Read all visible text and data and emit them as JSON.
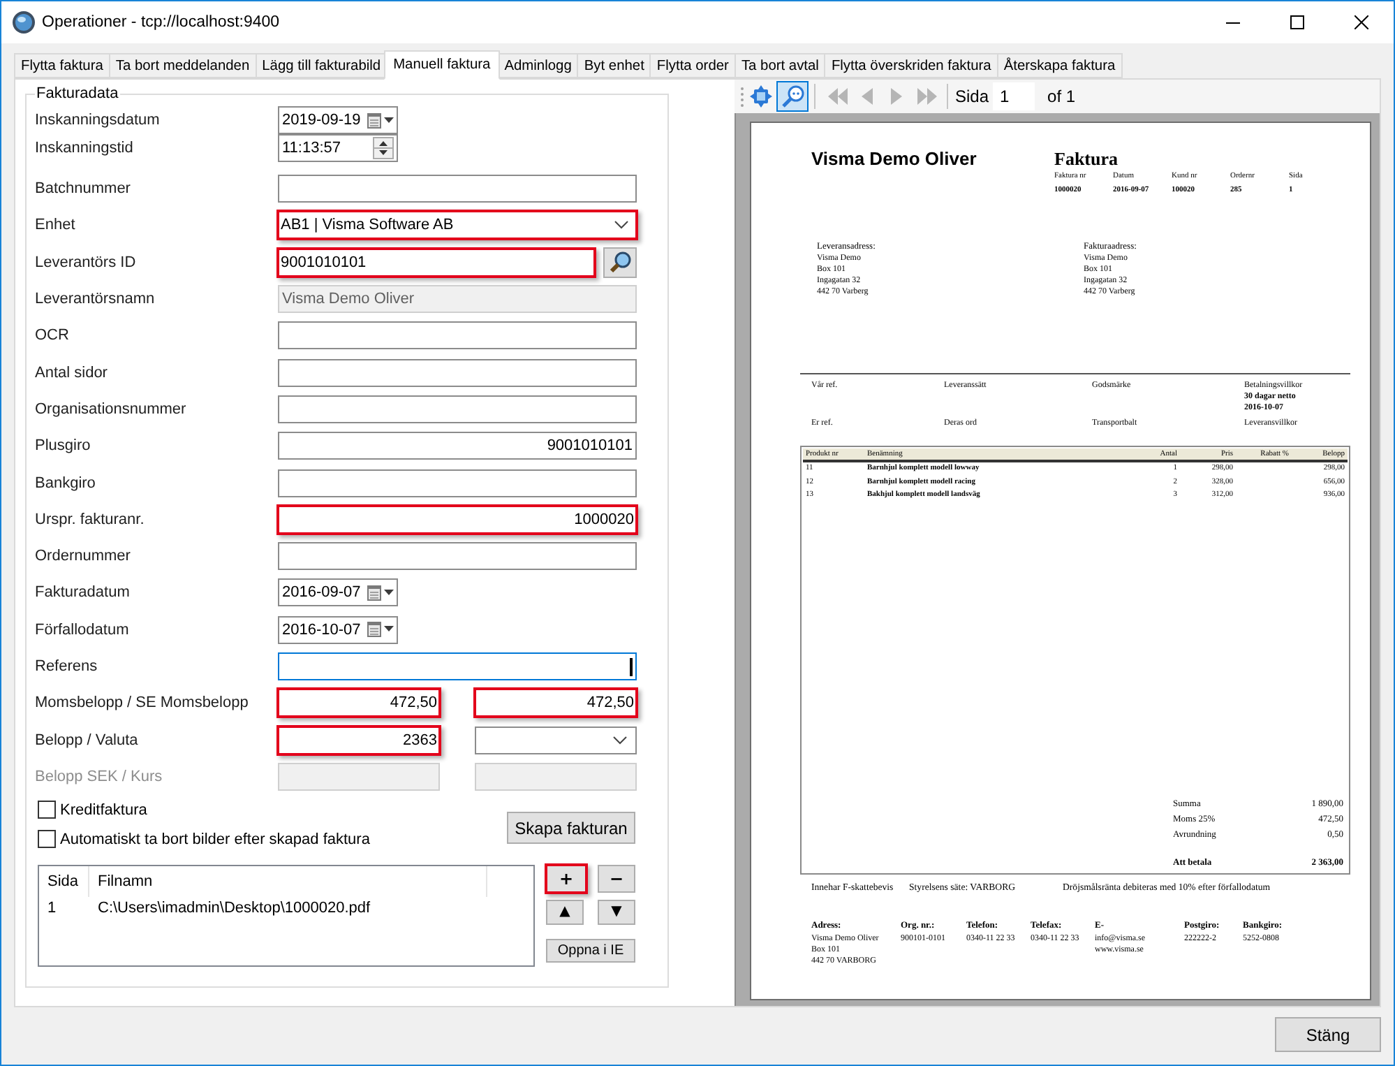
{
  "window": {
    "title": "Operationer - tcp://localhost:9400"
  },
  "tabs": [
    {
      "label": "Flytta faktura",
      "selected": false
    },
    {
      "label": "Ta bort meddelanden",
      "selected": false
    },
    {
      "label": "Lägg till fakturabild",
      "selected": false
    },
    {
      "label": "Manuell faktura",
      "selected": true
    },
    {
      "label": "Adminlogg",
      "selected": false
    },
    {
      "label": "Byt enhet",
      "selected": false
    },
    {
      "label": "Flytta order",
      "selected": false
    },
    {
      "label": "Ta bort avtal",
      "selected": false
    },
    {
      "label": "Flytta överskriden faktura",
      "selected": false
    },
    {
      "label": "Återskapa faktura",
      "selected": false
    }
  ],
  "form": {
    "title": "Fakturadata",
    "rows": [
      {
        "label": "Inskanningsdatum",
        "disabled": false,
        "inputs": [
          {
            "kind": "date",
            "value": "2019-09-19",
            "highlighted": false,
            "disabled": false,
            "focused": false
          }
        ]
      },
      {
        "label": "Inskanningstid",
        "disabled": false,
        "inputs": [
          {
            "kind": "time",
            "value": "11:13:57",
            "highlighted": false,
            "disabled": false,
            "focused": false
          }
        ]
      },
      {
        "label": "Batchnummer",
        "disabled": false,
        "inputs": [
          {
            "kind": "text",
            "highlighted": false,
            "disabled": false,
            "focused": false
          }
        ]
      },
      {
        "label": "Enhet",
        "disabled": false,
        "inputs": [
          {
            "kind": "combo",
            "value": "AB1 | Visma Software AB",
            "highlighted": true,
            "disabled": false,
            "focused": false
          }
        ]
      },
      {
        "label": "Leverantörs ID",
        "disabled": false,
        "inputs": [
          {
            "kind": "lookup",
            "value": "9001010101",
            "highlighted": true,
            "disabled": false,
            "focused": false
          }
        ]
      },
      {
        "label": "Leverantörsnamn",
        "disabled": false,
        "inputs": [
          {
            "kind": "text",
            "value": "Visma Demo Oliver",
            "highlighted": false,
            "disabled": true,
            "focused": false
          }
        ]
      },
      {
        "label": "OCR",
        "disabled": false,
        "inputs": [
          {
            "kind": "text",
            "highlighted": false,
            "disabled": false,
            "focused": false
          }
        ]
      },
      {
        "label": "Antal sidor",
        "disabled": false,
        "inputs": [
          {
            "kind": "text",
            "highlighted": false,
            "disabled": false,
            "focused": false
          }
        ]
      },
      {
        "label": "Organisationsnummer",
        "disabled": false,
        "inputs": [
          {
            "kind": "text",
            "highlighted": false,
            "disabled": false,
            "focused": false
          }
        ]
      },
      {
        "label": "Plusgiro",
        "disabled": false,
        "inputs": [
          {
            "kind": "number",
            "value": "9001010101",
            "highlighted": false,
            "disabled": false,
            "focused": false
          }
        ]
      },
      {
        "label": "Bankgiro",
        "disabled": false,
        "inputs": [
          {
            "kind": "text",
            "highlighted": false,
            "disabled": false,
            "focused": false
          }
        ]
      },
      {
        "label": "Urspr. fakturanr.",
        "disabled": false,
        "inputs": [
          {
            "kind": "number",
            "value": "1000020",
            "highlighted": true,
            "disabled": false,
            "focused": false
          }
        ]
      },
      {
        "label": "Ordernummer",
        "disabled": false,
        "inputs": [
          {
            "kind": "text",
            "highlighted": false,
            "disabled": false,
            "focused": false
          }
        ]
      },
      {
        "label": "Fakturadatum",
        "disabled": false,
        "inputs": [
          {
            "kind": "date",
            "value": "2016-09-07",
            "highlighted": false,
            "disabled": false,
            "focused": false
          }
        ]
      },
      {
        "label": "Förfallodatum",
        "disabled": false,
        "inputs": [
          {
            "kind": "date",
            "value": "2016-10-07",
            "highlighted": false,
            "disabled": false,
            "focused": false
          }
        ]
      },
      {
        "label": "Referens",
        "disabled": false,
        "inputs": [
          {
            "kind": "number",
            "highlighted": false,
            "disabled": false,
            "focused": true
          }
        ]
      },
      {
        "label": "Momsbelopp / SE Momsbelopp",
        "disabled": false,
        "inputs": [
          {
            "kind": "number",
            "value": "472,50",
            "highlighted": true,
            "disabled": false,
            "focused": false
          },
          {
            "kind": "number",
            "value": "472,50",
            "highlighted": true,
            "disabled": false,
            "focused": false
          }
        ]
      },
      {
        "label": "Belopp / Valuta",
        "disabled": false,
        "inputs": [
          {
            "kind": "number",
            "value": "2363",
            "highlighted": true,
            "disabled": false,
            "focused": false
          },
          {
            "kind": "combo",
            "highlighted": false,
            "disabled": false,
            "focused": false
          }
        ]
      },
      {
        "label": "Belopp SEK / Kurs",
        "disabled": true,
        "inputs": [
          {
            "kind": "text",
            "highlighted": false,
            "disabled": true,
            "focused": false
          },
          {
            "kind": "text",
            "highlighted": false,
            "disabled": true,
            "focused": false
          }
        ]
      }
    ],
    "checkboxes": [
      {
        "label": "Kreditfaktura",
        "checked": false
      },
      {
        "label": "Automatiskt ta bort bilder efter skapad faktura",
        "checked": false
      }
    ],
    "create_button": "Skapa fakturan",
    "files": {
      "columns": [
        "Sida",
        "Filnamn"
      ],
      "rows": [
        {
          "page": "1",
          "file": "C:\\Users\\imadmin\\Desktop\\1000020.pdf"
        }
      ]
    },
    "file_buttons": [
      {
        "kind": "add",
        "label": "+",
        "highlighted": true
      },
      {
        "kind": "remove",
        "label": "−",
        "highlighted": false
      },
      {
        "kind": "up",
        "label": "▲",
        "highlighted": false
      },
      {
        "kind": "down",
        "label": "▼",
        "highlighted": false
      },
      {
        "kind": "open",
        "label": "Oppna i IE",
        "highlighted": false
      }
    ]
  },
  "preview": {
    "toolbar": {
      "tools": [
        {
          "kind": "fit",
          "selected": false,
          "disabled": false
        },
        {
          "kind": "zoom",
          "selected": true,
          "disabled": false
        },
        {
          "kind": "first",
          "selected": false,
          "disabled": true
        },
        {
          "kind": "previous",
          "selected": false,
          "disabled": true
        },
        {
          "kind": "next",
          "selected": false,
          "disabled": true
        },
        {
          "kind": "last",
          "selected": false,
          "disabled": true
        }
      ],
      "page_label": "Sida",
      "page_value": "1",
      "page_total": "of 1"
    },
    "document": {
      "company": "Visma Demo Oliver",
      "title": "Faktura",
      "header": [
        {
          "label": "Faktura nr",
          "value": "1000020"
        },
        {
          "label": "Datum",
          "value": "2016-09-07"
        },
        {
          "label": "Kund nr",
          "value": "100020"
        },
        {
          "label": "Ordernr",
          "value": "285"
        },
        {
          "label": "Sida",
          "value": "1"
        }
      ],
      "addresses": [
        {
          "heading": "Leveransadress:",
          "lines": [
            "Visma Demo",
            "Box 101",
            "Ingagatan 32",
            "442 70 Varberg"
          ]
        },
        {
          "heading": "Fakturaadress:",
          "lines": [
            "Visma Demo",
            "Box 101",
            "Ingagatan 32",
            "442 70 Varberg"
          ]
        }
      ],
      "references": [
        {
          "label": "Vår ref."
        },
        {
          "label": "Leveranssätt"
        },
        {
          "label": "Godsmärke"
        },
        {
          "label": "Betalningsvillkor",
          "values": [
            "30 dagar netto",
            "2016-10-07"
          ]
        },
        {
          "label": "Er ref."
        },
        {
          "label": "Deras ord"
        },
        {
          "label": "Transportbalt"
        },
        {
          "label": "Leveransvillkor"
        }
      ],
      "table": {
        "columns": [
          "Produkt nr",
          "Benämning",
          "Antal",
          "Pris",
          "Rabatt %",
          "Belopp"
        ],
        "rows": [
          {
            "product": "11",
            "name": "Barnhjul komplett modell lowway",
            "quantity": "1",
            "price": "298,00",
            "amount": "298,00"
          },
          {
            "product": "12",
            "name": "Barnhjul komplett modell racing",
            "quantity": "2",
            "price": "328,00",
            "amount": "656,00"
          },
          {
            "product": "13",
            "name": "Bakhjul komplett modell landsväg",
            "quantity": "3",
            "price": "312,00",
            "amount": "936,00"
          }
        ]
      },
      "totals": [
        {
          "kind": "sum",
          "label": "Summa",
          "value": "1 890,00"
        },
        {
          "kind": "sum",
          "label": "Moms 25%",
          "value": "472,50"
        },
        {
          "kind": "sum",
          "label": "Avrundning",
          "value": "0,50"
        },
        {
          "kind": "total",
          "label": "Att betala",
          "value": "2 363,00"
        }
      ],
      "notes": [
        "Innehar F-skattebevis",
        "Styrelsens säte: VARBORG",
        "Dröjsmålsränta debiteras med 10% efter förfallodatum"
      ],
      "footer": [
        {
          "heading": "Adress:",
          "lines": [
            "Visma Demo Oliver",
            "Box 101",
            "442 70 VARBORG"
          ]
        },
        {
          "heading": "Org. nr.:",
          "lines": [
            "900101-0101"
          ]
        },
        {
          "heading": "Telefon:",
          "lines": [
            "0340-11 22 33"
          ]
        },
        {
          "heading": "Telefax:",
          "lines": [
            "0340-11 22 33"
          ]
        },
        {
          "heading": "E-",
          "lines": [
            "info@visma.se",
            "www.visma.se"
          ]
        },
        {
          "heading": "Postgiro:",
          "lines": [
            "222222-2"
          ]
        },
        {
          "heading": "Bankgiro:",
          "lines": [
            "5252-0808"
          ]
        }
      ]
    }
  },
  "close_button": "Stäng"
}
